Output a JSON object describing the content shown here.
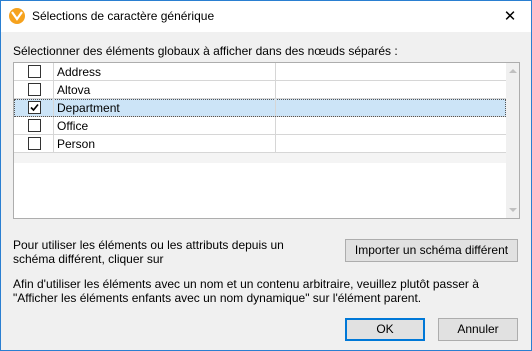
{
  "window": {
    "title": "Sélections de caractère générique",
    "close_glyph": "✕",
    "app_icon": "altova-logo-icon"
  },
  "instruction": "Sélectionner des éléments globaux à afficher dans des nœuds séparés :",
  "elements": [
    {
      "name": "Address",
      "checked": false
    },
    {
      "name": "Altova",
      "checked": false
    },
    {
      "name": "Department",
      "checked": true
    },
    {
      "name": "Office",
      "checked": false
    },
    {
      "name": "Person",
      "checked": false
    }
  ],
  "import_section": {
    "text": "Pour utiliser les éléments ou les attributs depuis un schéma différent, cliquer sur",
    "button_label": "Importer un schéma différent"
  },
  "dynamic_info": "Afin d'utiliser les éléments avec un nom et un contenu arbitraire, veuillez plutôt passer à \"Afficher les éléments enfants avec un nom dynamique\" sur l'élément parent.",
  "buttons": {
    "ok_label": "OK",
    "cancel_label": "Annuler"
  },
  "colors": {
    "selected_row": "#cce4f7",
    "accent": "#0078d7",
    "app_icon": "#f6a21d"
  }
}
